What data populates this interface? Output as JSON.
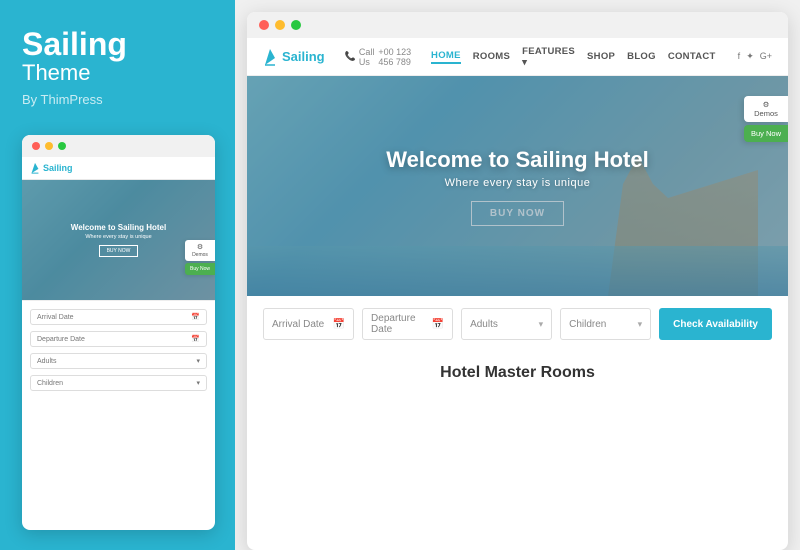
{
  "left": {
    "brand": {
      "title": "Sailing",
      "sub": "Theme",
      "by": "By ThimPress"
    },
    "mini_browser": {
      "logo": "Sailing",
      "hero": {
        "title": "Welcome to Sailing Hotel",
        "sub": "Where every stay is unique",
        "buy_now": "BUY NOW"
      },
      "side_btns": {
        "demos": "Demos",
        "buy_now": "Buy Now"
      },
      "booking": {
        "arrival": "Arrival Date",
        "departure": "Departure Date",
        "adults": "Adults",
        "children": "Children"
      }
    }
  },
  "right": {
    "nav": {
      "logo": "Sailing",
      "phone_label": "Call Us",
      "phone": "+00 123 456 789",
      "links": [
        "HOME",
        "ROOMS",
        "FEATURES",
        "SHOP",
        "BLOG",
        "CONTACT"
      ],
      "social": [
        "f",
        "y+",
        "G+"
      ]
    },
    "hero": {
      "title": "Welcome to Sailing Hotel",
      "sub": "Where every stay is unique",
      "buy_now": "BUY NOW"
    },
    "side_btns": {
      "demos": "Demos",
      "buy_now": "Buy Now"
    },
    "booking": {
      "arrival": "Arrival Date",
      "departure": "Departure Date",
      "adults": "Adults",
      "children": "Children",
      "check_btn": "Check Availability"
    },
    "rooms_section": {
      "title": "Hotel Master Rooms"
    }
  }
}
